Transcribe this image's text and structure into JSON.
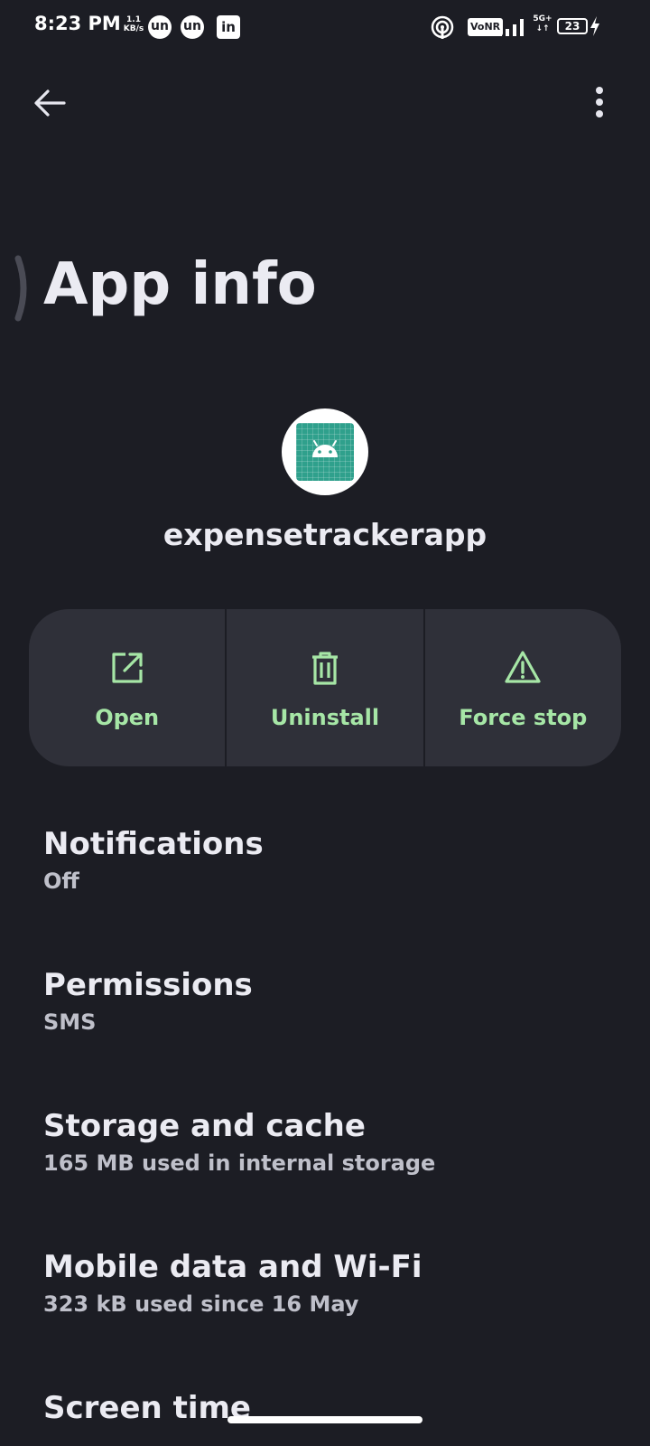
{
  "status_bar": {
    "time": "8:23 PM",
    "net_speed_value": "1.1",
    "net_speed_unit": "KB/s",
    "notif_icons": [
      "un",
      "un"
    ],
    "linkedin_label": "in",
    "volte": "VoNR",
    "network_type_top": "5G+",
    "network_type_bottom": "↓↑",
    "battery": "23"
  },
  "header": {
    "title": "App info"
  },
  "app": {
    "name": "expensetrackerapp"
  },
  "actions": [
    {
      "label": "Open",
      "icon": "open-external-icon"
    },
    {
      "label": "Uninstall",
      "icon": "trash-icon"
    },
    {
      "label": "Force stop",
      "icon": "warning-icon"
    }
  ],
  "settings": [
    {
      "title": "Notifications",
      "subtitle": "Off"
    },
    {
      "title": "Permissions",
      "subtitle": "SMS"
    },
    {
      "title": "Storage and cache",
      "subtitle": "165 MB used in internal storage"
    },
    {
      "title": "Mobile data and Wi-Fi",
      "subtitle": "323 kB used since 16 May"
    },
    {
      "title": "Screen time",
      "subtitle": ""
    }
  ],
  "colors": {
    "background": "#1c1d24",
    "card": "#2f3039",
    "accent": "#a6e6a6",
    "app_icon_bg": "#2fa08c"
  }
}
